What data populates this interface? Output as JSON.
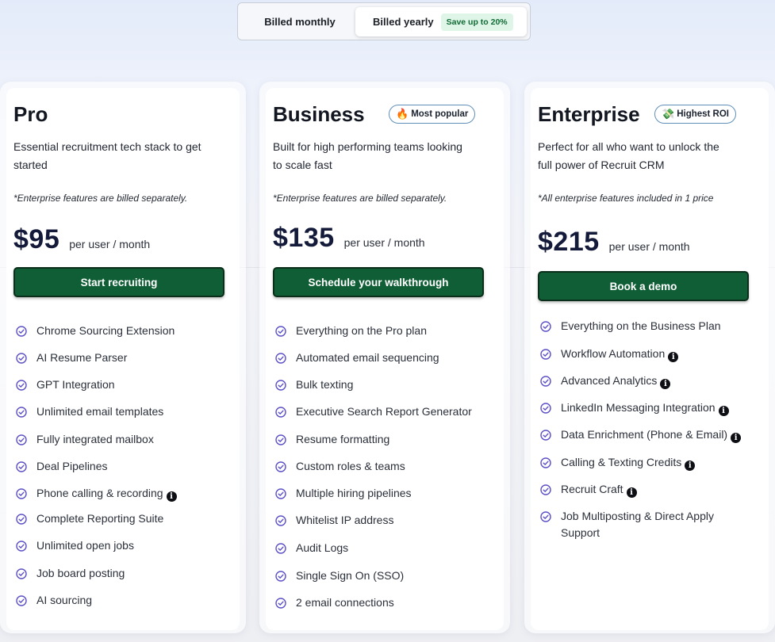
{
  "billing": {
    "monthly_label": "Billed monthly",
    "yearly_label": "Billed yearly",
    "save_badge": "Save up to 20%",
    "selected": "yearly"
  },
  "colors": {
    "accent_green": "#0f5e35",
    "badge_border": "#5f8fb8",
    "check_purple": "#5b4fc6",
    "price_navy": "#141a3a"
  },
  "plans": [
    {
      "name": "Pro",
      "badge": null,
      "description": "Essential recruitment tech stack to get started",
      "note": "*Enterprise features are billed separately.",
      "price": "$95",
      "price_unit": "per user / month",
      "cta": "Start recruiting",
      "features": [
        {
          "text": "Chrome Sourcing Extension",
          "info": false
        },
        {
          "text": "AI Resume Parser",
          "info": false
        },
        {
          "text": "GPT Integration",
          "info": false
        },
        {
          "text": "Unlimited email templates",
          "info": false
        },
        {
          "text": "Fully integrated mailbox",
          "info": false
        },
        {
          "text": "Deal Pipelines",
          "info": false
        },
        {
          "text": "Phone calling & recording",
          "info": true
        },
        {
          "text": "Complete Reporting Suite",
          "info": false
        },
        {
          "text": "Unlimited open jobs",
          "info": false
        },
        {
          "text": "Job board posting",
          "info": false
        },
        {
          "text": "AI sourcing",
          "info": false
        }
      ]
    },
    {
      "name": "Business",
      "badge": {
        "icon": "fire-icon",
        "glyph": "🔥",
        "label": "Most popular"
      },
      "description": "Built for high performing teams looking to scale fast",
      "note": "*Enterprise features are billed separately.",
      "price": "$135",
      "price_unit": "per user / month",
      "cta": "Schedule your walkthrough",
      "features": [
        {
          "text": "Everything on the Pro plan",
          "info": false
        },
        {
          "text": "Automated email sequencing",
          "info": false
        },
        {
          "text": "Bulk texting",
          "info": false
        },
        {
          "text": "Executive Search Report Generator",
          "info": false
        },
        {
          "text": "Resume formatting",
          "info": false
        },
        {
          "text": "Custom roles & teams",
          "info": false
        },
        {
          "text": "Multiple hiring pipelines",
          "info": false
        },
        {
          "text": "Whitelist IP address",
          "info": false
        },
        {
          "text": "Audit Logs",
          "info": false
        },
        {
          "text": "Single Sign On (SSO)",
          "info": false
        },
        {
          "text": "2 email connections",
          "info": false
        }
      ]
    },
    {
      "name": "Enterprise",
      "badge": {
        "icon": "money-icon",
        "glyph": "💸",
        "label": "Highest ROI"
      },
      "description": "Perfect for all who want to unlock the full power of Recruit CRM",
      "note": "*All enterprise features included in 1 price",
      "price": "$215",
      "price_unit": "per user / month",
      "cta": "Book a demo",
      "features": [
        {
          "text": "Everything on the Business Plan",
          "info": false
        },
        {
          "text": "Workflow Automation",
          "info": true
        },
        {
          "text": "Advanced Analytics",
          "info": true
        },
        {
          "text": "LinkedIn Messaging Integration",
          "info": true
        },
        {
          "text": "Data Enrichment (Phone & Email)",
          "info": true
        },
        {
          "text": "Calling & Texting Credits",
          "info": true
        },
        {
          "text": "Recruit Craft",
          "info": true
        },
        {
          "text": "Job Multiposting & Direct Apply Support",
          "info": false
        }
      ]
    }
  ]
}
